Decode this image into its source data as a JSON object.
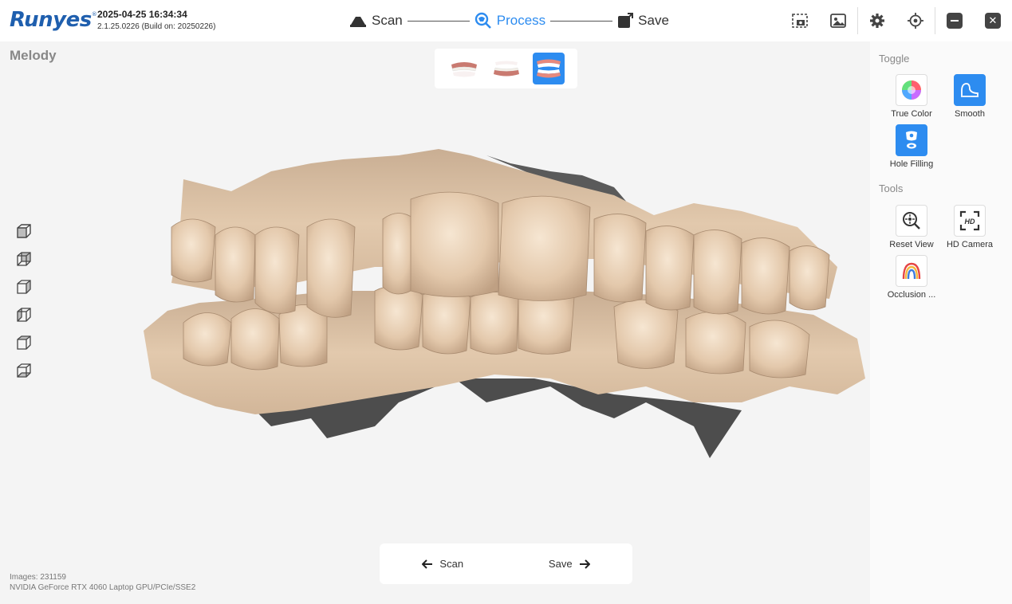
{
  "header": {
    "logo": "Runyes",
    "logo_mark": "®",
    "datetime": "2025-04-25 16:34:34",
    "build": "2.1.25.0226 (Build on: 20250226)"
  },
  "workflow": {
    "steps": [
      {
        "label": "Scan",
        "icon": "scanner-icon",
        "active": false
      },
      {
        "label": "Process",
        "icon": "process-icon",
        "active": true
      },
      {
        "label": "Save",
        "icon": "save-icon",
        "active": false
      }
    ],
    "active_color": "#2d8cf0"
  },
  "patient": {
    "name": "Melody"
  },
  "jaw_views": [
    {
      "name": "upper-jaw",
      "active": false
    },
    {
      "name": "lower-jaw",
      "active": false
    },
    {
      "name": "both-jaws",
      "active": true
    }
  ],
  "right_panel": {
    "toggle_title": "Toggle",
    "toggles": [
      {
        "label": "True Color",
        "icon": "color-wheel-icon",
        "on": false
      },
      {
        "label": "Smooth",
        "icon": "smooth-icon",
        "on": true
      },
      {
        "label": "Hole Filling",
        "icon": "hole-filling-icon",
        "on": true
      }
    ],
    "tools_title": "Tools",
    "tools": [
      {
        "label": "Reset View",
        "icon": "reset-view-icon"
      },
      {
        "label": "HD Camera",
        "icon": "hd-camera-icon"
      },
      {
        "label": "Occlusion ...",
        "icon": "occlusion-icon"
      }
    ]
  },
  "bottom_nav": {
    "back_label": "Scan",
    "next_label": "Save"
  },
  "footer": {
    "images": "Images: 231159",
    "gpu": "NVIDIA GeForce RTX 4060 Laptop GPU/PCIe/SSE2"
  },
  "colors": {
    "accent": "#2d8cf0",
    "model": "#dcc3a8",
    "model_shadow": "#4a4a4a"
  }
}
